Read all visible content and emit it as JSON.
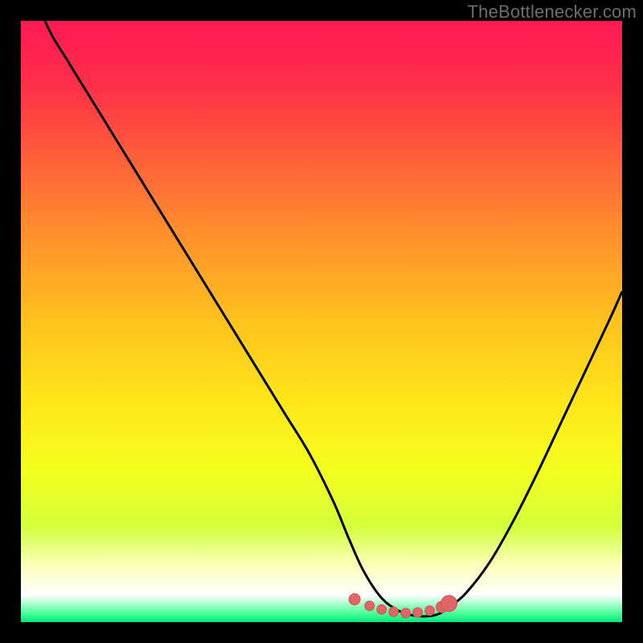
{
  "attribution": {
    "label": "TheBottlenecker.com"
  },
  "colors": {
    "gradient_stops": [
      {
        "offset": 0.0,
        "color": "#ff1a54"
      },
      {
        "offset": 0.1,
        "color": "#ff2d4a"
      },
      {
        "offset": 0.22,
        "color": "#ff5c3a"
      },
      {
        "offset": 0.35,
        "color": "#ff8e2d"
      },
      {
        "offset": 0.5,
        "color": "#ffc21e"
      },
      {
        "offset": 0.63,
        "color": "#ffe51a"
      },
      {
        "offset": 0.75,
        "color": "#f3ff1e"
      },
      {
        "offset": 0.84,
        "color": "#d4ff3a"
      },
      {
        "offset": 0.905,
        "color": "#fbffb8"
      },
      {
        "offset": 0.955,
        "color": "#ffffff"
      },
      {
        "offset": 0.985,
        "color": "#4fff97"
      },
      {
        "offset": 1.0,
        "color": "#00e87a"
      }
    ],
    "curve_stroke": "#000000",
    "marker_fill": "#e06666",
    "marker_stroke": "#cc5555"
  },
  "chart_data": {
    "type": "line",
    "title": "",
    "xlabel": "",
    "ylabel": "",
    "xlim": [
      0,
      100
    ],
    "ylim": [
      0,
      100
    ],
    "series": [
      {
        "name": "bottleneck-curve",
        "x": [
          0,
          4,
          8,
          12,
          16,
          20,
          24,
          28,
          32,
          36,
          40,
          44,
          48,
          52,
          54.5,
          57,
          60,
          63,
          66,
          69,
          71,
          74,
          78,
          82,
          86,
          90,
          94,
          98,
          100
        ],
        "values": [
          112,
          100,
          93,
          86.5,
          80,
          73.5,
          67,
          60.5,
          54,
          47.5,
          41,
          34.5,
          28,
          20,
          14,
          8.5,
          4,
          1.8,
          1.0,
          1.2,
          2.3,
          4.8,
          10,
          17,
          25,
          33.5,
          42,
          50.5,
          55
        ]
      }
    ],
    "markers": {
      "name": "optimal-range",
      "type": "scatter",
      "x": [
        55.5,
        58,
        60,
        62,
        64,
        66,
        68,
        70,
        71.2
      ],
      "values": [
        3.8,
        2.7,
        2.1,
        1.7,
        1.5,
        1.6,
        1.9,
        2.5,
        3.1
      ],
      "radius": [
        7,
        6,
        6,
        6,
        6,
        6,
        6,
        7,
        10
      ]
    }
  }
}
